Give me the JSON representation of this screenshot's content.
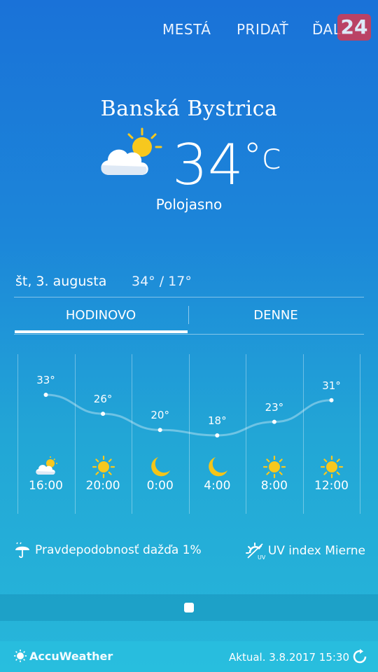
{
  "nav": {
    "cities": "MESTÁ",
    "add": "PRIDAŤ",
    "more": "ĎAL"
  },
  "badge": "24",
  "current": {
    "city": "Banská Bystrica",
    "temperature": "34",
    "unit": "°c",
    "condition": "Polojasno",
    "icon": "partly-cloudy-icon"
  },
  "today": {
    "date": "št, 3. augusta",
    "range": "34° / 17°"
  },
  "tabs": {
    "hourly": "HODINOVO",
    "daily": "DENNE",
    "active": "hourly"
  },
  "hourly": [
    {
      "time": "16:00",
      "temp": "33°",
      "value": 33,
      "icon": "partly-cloudy-icon"
    },
    {
      "time": "20:00",
      "temp": "26°",
      "value": 26,
      "icon": "sun-icon"
    },
    {
      "time": "0:00",
      "temp": "20°",
      "value": 20,
      "icon": "moon-icon"
    },
    {
      "time": "4:00",
      "temp": "18°",
      "value": 18,
      "icon": "moon-icon"
    },
    {
      "time": "8:00",
      "temp": "23°",
      "value": 23,
      "icon": "sun-icon"
    },
    {
      "time": "12:00",
      "temp": "31°",
      "value": 31,
      "icon": "sun-icon"
    }
  ],
  "details": {
    "rain": "Pravdepodobnosť dažďa 1%",
    "uv": "UV index Mierne"
  },
  "footer": {
    "brand": "AccuWeather",
    "updated": "Aktual. 3.8.2017 15:30"
  },
  "colors": {
    "sun": "#f7c81e",
    "moon": "#f5c518",
    "cloud": "#ffffff"
  }
}
